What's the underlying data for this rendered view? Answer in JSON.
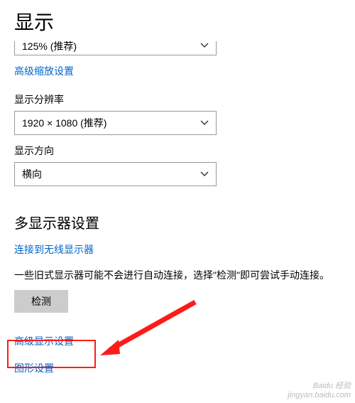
{
  "page": {
    "title": "显示"
  },
  "scale": {
    "value": "125% (推荐)"
  },
  "links": {
    "advanced_scaling": "高级缩放设置",
    "connect_wireless": "连接到无线显示器",
    "advanced_display": "高级显示设置",
    "graphics_settings": "图形设置"
  },
  "labels": {
    "resolution": "显示分辨率",
    "orientation": "显示方向"
  },
  "resolution": {
    "value": "1920 × 1080 (推荐)"
  },
  "orientation": {
    "value": "横向"
  },
  "sections": {
    "multi_display": "多显示器设置"
  },
  "desc": {
    "legacy_text": "一些旧式显示器可能不会进行自动连接，选择\"检测\"即可尝试手动连接。"
  },
  "buttons": {
    "detect": "检测"
  },
  "watermark": {
    "line1": "Baidu 经验",
    "line2": "jingyan.baidu.com"
  }
}
